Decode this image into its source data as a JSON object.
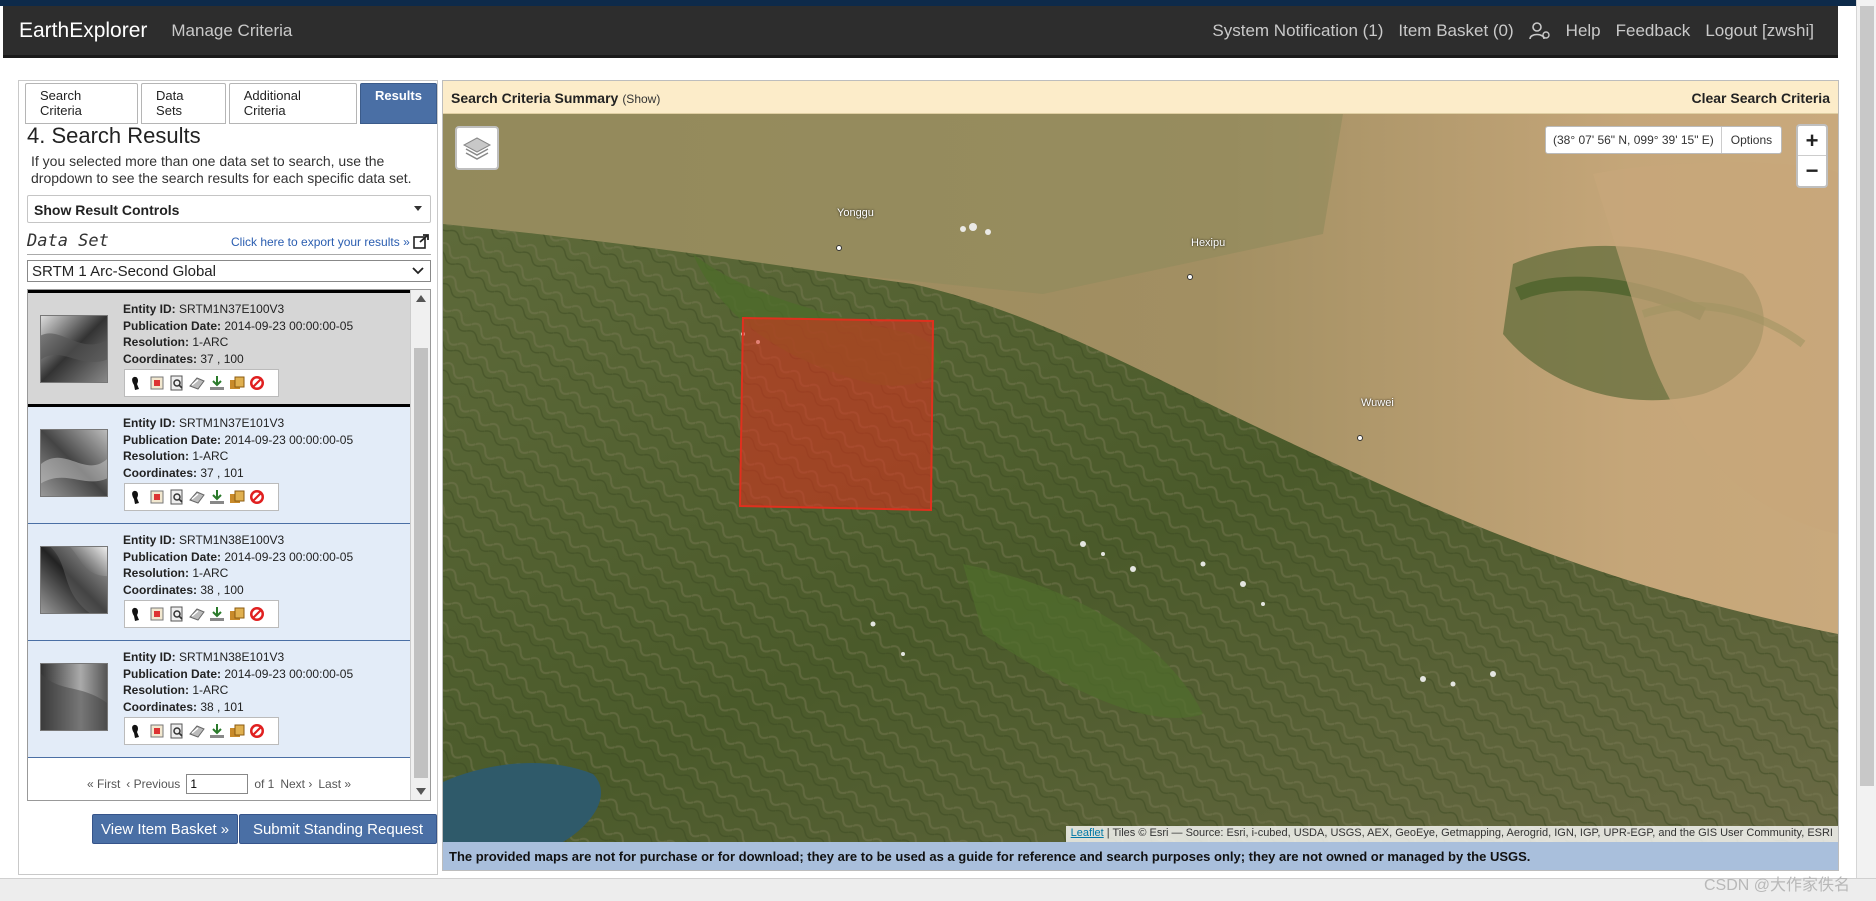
{
  "navbar": {
    "brand": "EarthExplorer",
    "manage_criteria": "Manage Criteria",
    "system_notification": "System Notification (1)",
    "item_basket": "Item Basket (0)",
    "help": "Help",
    "feedback": "Feedback",
    "logout": "Logout [zwshi]"
  },
  "tabs": [
    {
      "label": "Search Criteria"
    },
    {
      "label": "Data Sets"
    },
    {
      "label": "Additional Criteria"
    },
    {
      "label": "Results"
    }
  ],
  "results": {
    "title": "4. Search Results",
    "description": "If you selected more than one data set to search, use the dropdown to see the search results for each specific data set.",
    "show_controls": "Show Result Controls",
    "dataset_label": "Data Set",
    "export_link": "Click here to export your results »",
    "dataset_selected": "SRTM 1 Arc-Second Global",
    "field_labels": {
      "entity": "Entity ID:",
      "pubdate": "Publication Date:",
      "resolution": "Resolution:",
      "coordinates": "Coordinates:"
    },
    "items": [
      {
        "entity_id": "SRTM1N37E100V3",
        "publication_date": "2014-09-23 00:00:00-05",
        "resolution": "1-ARC",
        "coordinates": "37 , 100"
      },
      {
        "entity_id": "SRTM1N37E101V3",
        "publication_date": "2014-09-23 00:00:00-05",
        "resolution": "1-ARC",
        "coordinates": "37 , 101"
      },
      {
        "entity_id": "SRTM1N38E100V3",
        "publication_date": "2014-09-23 00:00:00-05",
        "resolution": "1-ARC",
        "coordinates": "38 , 100"
      },
      {
        "entity_id": "SRTM1N38E101V3",
        "publication_date": "2014-09-23 00:00:00-05",
        "resolution": "1-ARC",
        "coordinates": "38 , 101"
      }
    ],
    "tool_icons": [
      "footprint-icon",
      "overlay-icon",
      "metadata-icon",
      "compare-icon",
      "download-icon",
      "order-icon",
      "exclude-icon"
    ],
    "pager": {
      "first": "« First",
      "previous": "‹ Previous",
      "page_value": "1",
      "of_label": "of 1",
      "next": "Next ›",
      "last": "Last »"
    },
    "view_basket_button": "View Item Basket »",
    "standing_request_button": "Submit Standing Request »"
  },
  "map": {
    "criteria_title": "Search Criteria Summary",
    "criteria_show": "(Show)",
    "clear_criteria": "Clear Search Criteria",
    "coordinates_readout": "(38° 07' 56\" N, 099° 39' 15\" E)",
    "options_label": "Options",
    "zoom_in": "+",
    "zoom_out": "−",
    "places": [
      {
        "name": "Yonggu"
      },
      {
        "name": "Hexipu"
      },
      {
        "name": "Wuwei"
      }
    ],
    "attribution_link": "Leaflet",
    "attribution_text": " | Tiles © Esri — Source: Esri, i-cubed, USDA, USGS, AEX, GeoEye, Getmapping, Aerogrid, IGN, IGP, UPR-EGP, and the GIS User Community, ESRI",
    "disclaimer": "The provided maps are not for purchase or for download; they are to be used as a guide for reference and search purposes only; they are not owned or managed by the USGS."
  },
  "watermark": "CSDN @大作家佚名",
  "colors": {
    "nav_bg": "#2d2d2d",
    "accent_blue": "#4a6fa5",
    "criteria_bg": "#fcecc9",
    "footprint_red": "#e0301e"
  }
}
